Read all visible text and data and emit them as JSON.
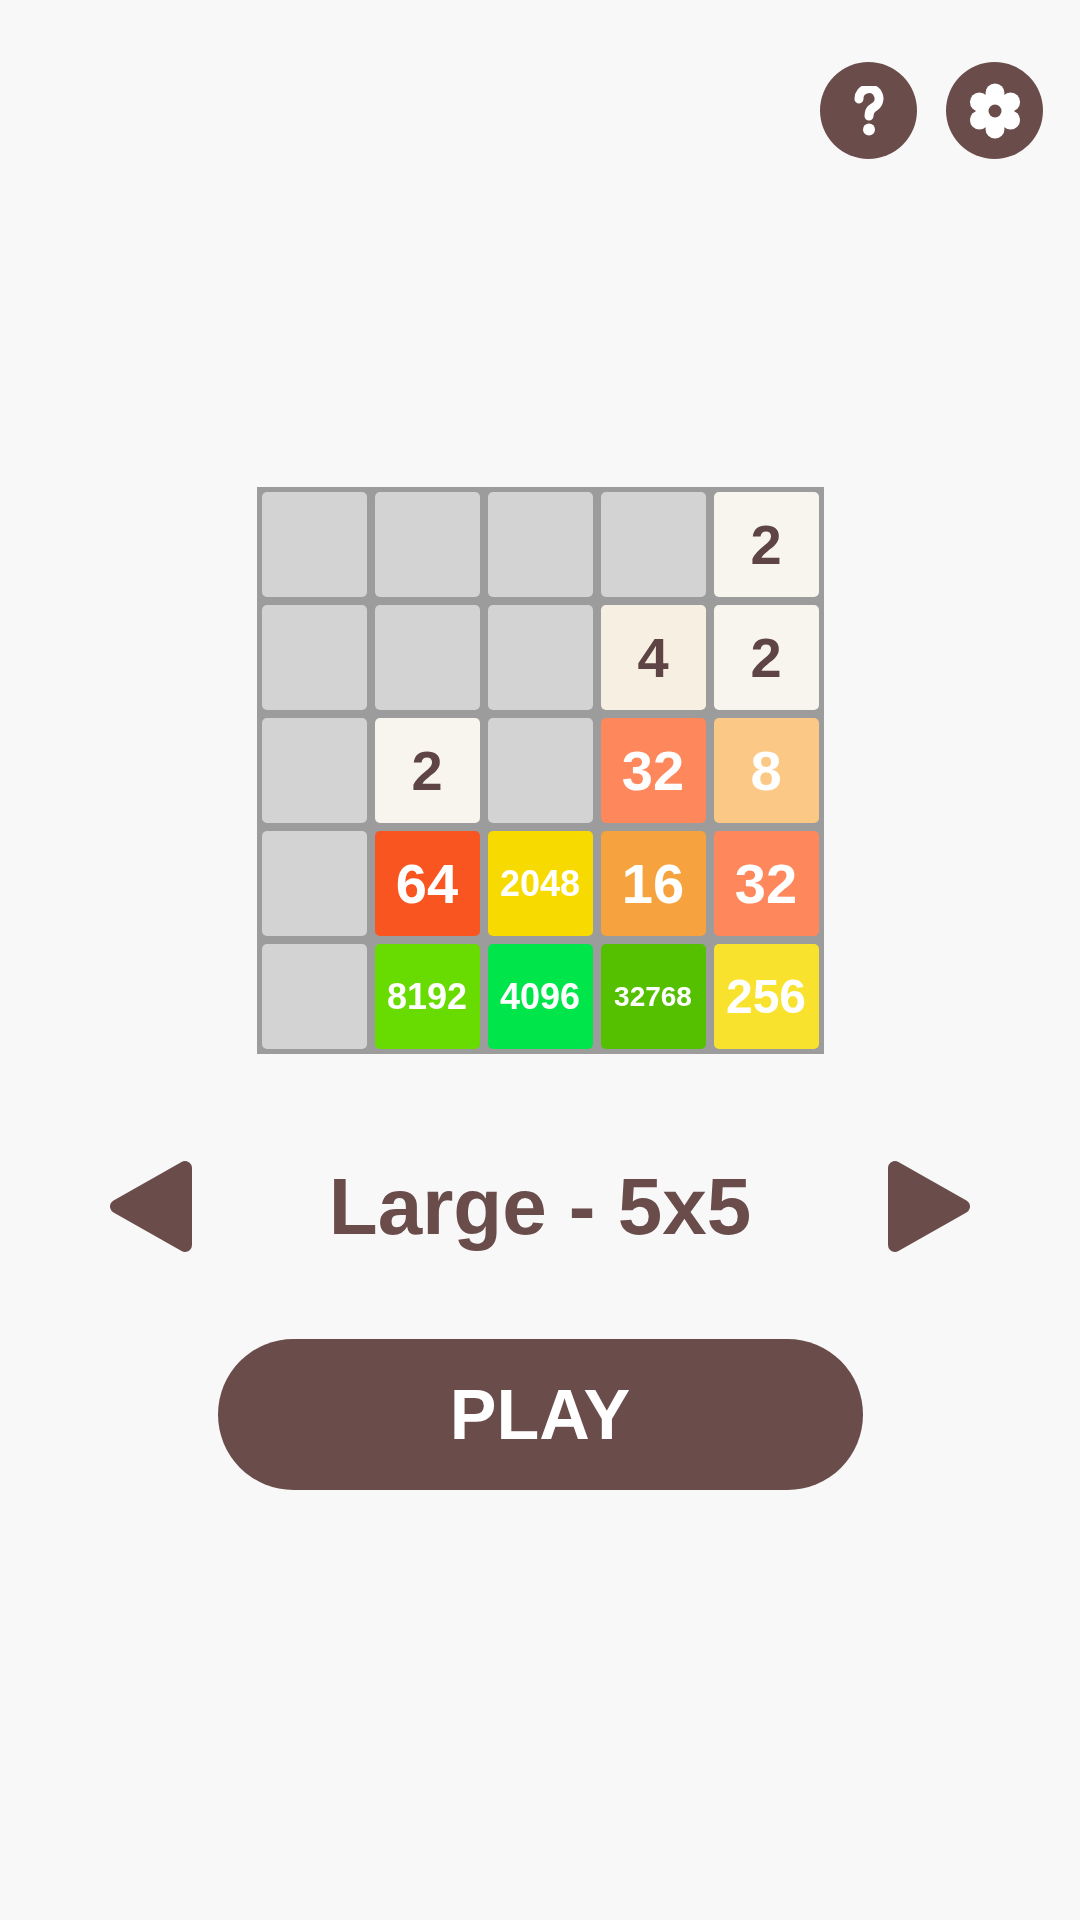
{
  "board": {
    "rows": [
      [
        {
          "kind": "empty",
          "color": "#d3d3d3"
        },
        {
          "kind": "empty",
          "color": "#d3d3d3"
        },
        {
          "kind": "empty",
          "color": "#d3d3d3"
        },
        {
          "kind": "empty",
          "color": "#d3d3d3"
        },
        {
          "kind": "pale",
          "color": "#f8f4ee",
          "value": "2"
        }
      ],
      [
        {
          "kind": "empty",
          "color": "#d3d3d3"
        },
        {
          "kind": "empty",
          "color": "#d3d3d3"
        },
        {
          "kind": "empty",
          "color": "#d3d3d3"
        },
        {
          "kind": "pale",
          "color": "#f7f0e2",
          "value": "4"
        },
        {
          "kind": "pale",
          "color": "#f8f4ee",
          "value": "2"
        }
      ],
      [
        {
          "kind": "empty",
          "color": "#d3d3d3"
        },
        {
          "kind": "pale",
          "color": "#f8f4ee",
          "value": "2"
        },
        {
          "kind": "empty",
          "color": "#d3d3d3"
        },
        {
          "kind": "vivid",
          "color": "#fe875c",
          "value": "32"
        },
        {
          "kind": "vivid",
          "color": "#fbc985",
          "value": "8"
        }
      ],
      [
        {
          "kind": "empty",
          "color": "#d3d3d3"
        },
        {
          "kind": "vivid",
          "color": "#f85521",
          "value": "64"
        },
        {
          "kind": "vivid",
          "color": "#f7da00",
          "value": "2048"
        },
        {
          "kind": "vivid",
          "color": "#f6a33f",
          "value": "16"
        },
        {
          "kind": "vivid",
          "color": "#fe875c",
          "value": "32"
        }
      ],
      [
        {
          "kind": "empty",
          "color": "#d3d3d3"
        },
        {
          "kind": "vivid",
          "color": "#68db00",
          "value": "8192"
        },
        {
          "kind": "vivid",
          "color": "#00e54a",
          "value": "4096"
        },
        {
          "kind": "vivid",
          "color": "#54c000",
          "value": "32768"
        },
        {
          "kind": "vivid",
          "color": "#f8e22e",
          "value": "256"
        }
      ]
    ]
  },
  "size_selector": {
    "label": "Large - 5x5"
  },
  "play_button": {
    "label": "PLAY"
  }
}
